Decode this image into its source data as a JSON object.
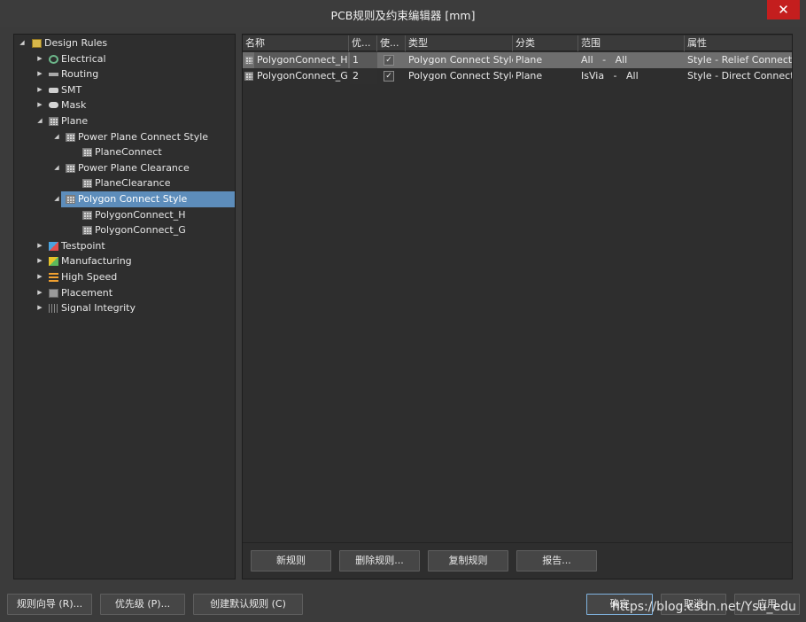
{
  "window": {
    "title": "PCB规则及约束编辑器 [mm]",
    "close_label": "✕"
  },
  "tree": {
    "root": "Design Rules",
    "categories": {
      "electrical": "Electrical",
      "routing": "Routing",
      "smt": "SMT",
      "mask": "Mask",
      "plane": "Plane",
      "testpoint": "Testpoint",
      "manufacturing": "Manufacturing",
      "high_speed": "High Speed",
      "placement": "Placement",
      "signal_integrity": "Signal Integrity"
    },
    "plane_children": {
      "power_plane_connect_style": "Power Plane Connect Style",
      "plane_connect": "PlaneConnect",
      "power_plane_clearance": "Power Plane Clearance",
      "plane_clearance": "PlaneClearance",
      "polygon_connect_style": "Polygon Connect Style",
      "polygon_connect_h": "PolygonConnect_H",
      "polygon_connect_g": "PolygonConnect_G"
    }
  },
  "grid": {
    "columns": {
      "name": "名称",
      "priority": "优...",
      "enabled": "使...",
      "type": "类型",
      "category": "分类",
      "scope": "范围",
      "attributes": "属性"
    },
    "rows": [
      {
        "name": "PolygonConnect_H",
        "priority": "1",
        "enabled": "✓",
        "type": "Polygon Connect Style",
        "category": "Plane",
        "scope": "All   -   All",
        "attributes": "Style - Relief Connect"
      },
      {
        "name": "PolygonConnect_G",
        "priority": "2",
        "enabled": "✓",
        "type": "Polygon Connect Style",
        "category": "Plane",
        "scope": "IsVia   -   All",
        "attributes": "Style - Direct Connect"
      }
    ]
  },
  "grid_buttons": {
    "new_rule": "新规则",
    "delete_rule": "删除规则...",
    "duplicate_rule": "复制规则",
    "report": "报告..."
  },
  "footer_buttons": {
    "rule_wizard": "规则向导 (R)...",
    "priorities": "优先级 (P)...",
    "create_default_rules": "创建默认规则 (C)",
    "ok": "确定",
    "cancel": "取消",
    "apply": "应用"
  },
  "watermark": "https://blog.csdn.net/Ysu_edu",
  "colors": {
    "selection": "#5d8dbb",
    "close": "#c41e1e",
    "background": "#3b3b3b"
  }
}
